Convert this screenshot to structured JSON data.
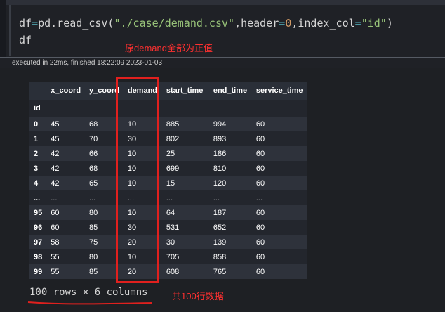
{
  "code_cell": {
    "line1": {
      "var": "df",
      "eq": "=",
      "call": "pd.read_csv(",
      "path": "\"./case/demand.csv\"",
      "comma1": ",",
      "kw_header": "header",
      "eq2": "=",
      "header_val": "0",
      "comma2": ",",
      "kw_index": "index_col",
      "eq3": "=",
      "index_val": "\"id\"",
      "close": ")"
    },
    "line2": "df"
  },
  "annotation_top": "原demand全部为正值",
  "exec_status": "executed in 22ms, finished 18:22:09 2023-01-03",
  "table": {
    "columns": [
      "x_coord",
      "y_coord",
      "demand",
      "start_time",
      "end_time",
      "service_time"
    ],
    "index_name": "id",
    "rows": [
      {
        "id": "0",
        "cells": [
          "45",
          "68",
          "10",
          "885",
          "994",
          "60"
        ]
      },
      {
        "id": "1",
        "cells": [
          "45",
          "70",
          "30",
          "802",
          "893",
          "60"
        ]
      },
      {
        "id": "2",
        "cells": [
          "42",
          "66",
          "10",
          "25",
          "186",
          "60"
        ]
      },
      {
        "id": "3",
        "cells": [
          "42",
          "68",
          "10",
          "699",
          "810",
          "60"
        ]
      },
      {
        "id": "4",
        "cells": [
          "42",
          "65",
          "10",
          "15",
          "120",
          "60"
        ]
      },
      {
        "id": "...",
        "cells": [
          "...",
          "...",
          "...",
          "...",
          "...",
          "..."
        ]
      },
      {
        "id": "95",
        "cells": [
          "60",
          "80",
          "10",
          "64",
          "187",
          "60"
        ]
      },
      {
        "id": "96",
        "cells": [
          "60",
          "85",
          "30",
          "531",
          "652",
          "60"
        ]
      },
      {
        "id": "97",
        "cells": [
          "58",
          "75",
          "20",
          "30",
          "139",
          "60"
        ]
      },
      {
        "id": "98",
        "cells": [
          "55",
          "80",
          "10",
          "705",
          "858",
          "60"
        ]
      },
      {
        "id": "99",
        "cells": [
          "55",
          "85",
          "20",
          "608",
          "765",
          "60"
        ]
      }
    ]
  },
  "shape_text": "100 rows × 6 columns",
  "annotation_bottom": "共100行数据",
  "colors": {
    "annotation_red": "#e0201e",
    "background": "#1f2126",
    "row_odd": "#2e323b",
    "row_even": "#23262d"
  }
}
